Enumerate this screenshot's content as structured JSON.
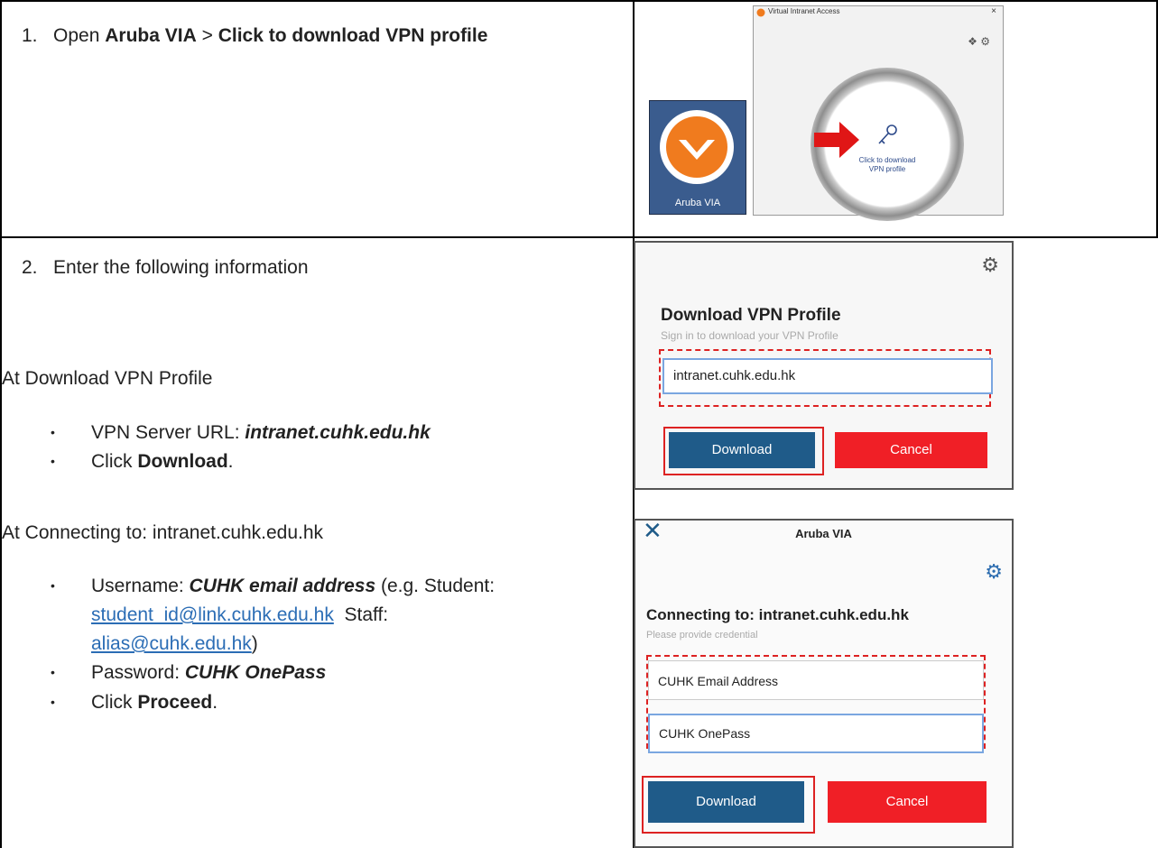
{
  "step1": {
    "number": "1.",
    "text_open": "Open",
    "app_name": "Aruba VIA",
    "sep": ">",
    "action": "Click to download VPN profile"
  },
  "app_icon": {
    "label": "Aruba VIA",
    "icon": "aruba-via-logo"
  },
  "window1": {
    "title": "Virtual Intranet Access",
    "close": "×",
    "settings_icons": "❖ ⚙",
    "ring_text": "Click to download\nVPN profile",
    "key_icon": "key-icon",
    "arrow_icon": "red-arrow"
  },
  "step2": {
    "number": "2.",
    "text": "Enter the following information",
    "section1_heading": "At Download VPN Profile",
    "bullets1": [
      {
        "prefix": "VPN Server URL: ",
        "value": "intranet.cuhk.edu.hk"
      },
      {
        "prefix": "Click ",
        "bold": "Download",
        "suffix": "."
      }
    ],
    "section2_heading": "At Connecting to: intranet.cuhk.edu.hk",
    "bullet_username_prefix": "Username: ",
    "bullet_username_value": "CUHK email address",
    "bullet_username_note1": " (e.g. Student:",
    "link_student": "student_id@link.cuhk.edu.hk",
    "staff_label": "Staff:",
    "link_staff": "alias@cuhk.edu.hk",
    "close_paren": ")",
    "bullet_password_prefix": "Password: ",
    "bullet_password_value": "CUHK OnePass",
    "bullet_proceed_prefix": "Click ",
    "bullet_proceed_bold": "Proceed",
    "bullet_proceed_suffix": "."
  },
  "window2": {
    "title": "Download VPN Profile",
    "subtitle": "Sign in to download your VPN Profile",
    "input_value": "intranet.cuhk.edu.hk",
    "download_label": "Download",
    "cancel_label": "Cancel"
  },
  "window3": {
    "title": "Aruba VIA",
    "close": "✕",
    "heading": "Connecting to: intranet.cuhk.edu.hk",
    "subtitle": "Please provide credential",
    "username_value": "CUHK Email Address",
    "password_value": "CUHK OnePass",
    "download_label": "Download",
    "cancel_label": "Cancel"
  },
  "colors": {
    "link": "#2b6db5",
    "accent_red": "#f01f26",
    "accent_blue": "#1f5b89",
    "aruba_orange": "#f07b1e"
  }
}
